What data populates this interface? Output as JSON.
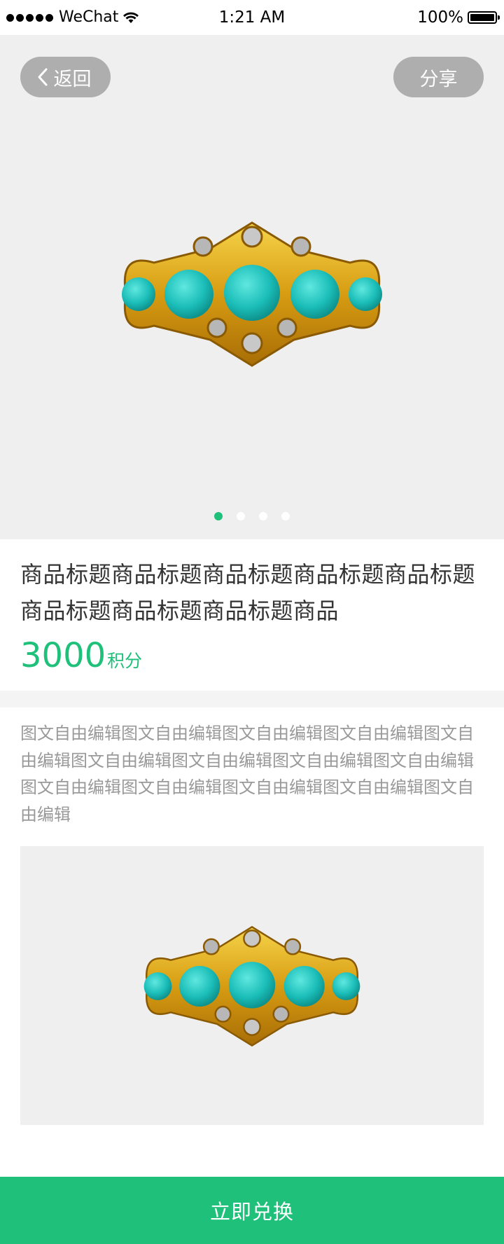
{
  "status_bar": {
    "carrier": "WeChat",
    "time": "1:21 AM",
    "battery": "100%"
  },
  "hero": {
    "back_label": "返回",
    "share_label": "分享",
    "carousel": {
      "total": 4,
      "active_index": 0
    }
  },
  "product": {
    "title": "商品标题商品标题商品标题商品标题商品标题商品标题商品标题商品标题商品",
    "price_value": "3000",
    "price_unit": "积分"
  },
  "detail": {
    "description": "图文自由编辑图文自由编辑图文自由编辑图文自由编辑图文自由编辑图文自由编辑图文自由编辑图文自由编辑图文自由编辑图文自由编辑图文自由编辑图文自由编辑图文自由编辑图文自由编辑"
  },
  "bottom_button": {
    "label": "立即兑换"
  },
  "colors": {
    "accent": "#1ec07a",
    "placeholder_bg": "#efefef",
    "text_primary": "#333333",
    "text_secondary": "#999999"
  },
  "icons": {
    "back": "chevron-left-icon",
    "wifi": "wifi-icon",
    "battery": "battery-icon",
    "signal": "signal-dots-icon"
  }
}
